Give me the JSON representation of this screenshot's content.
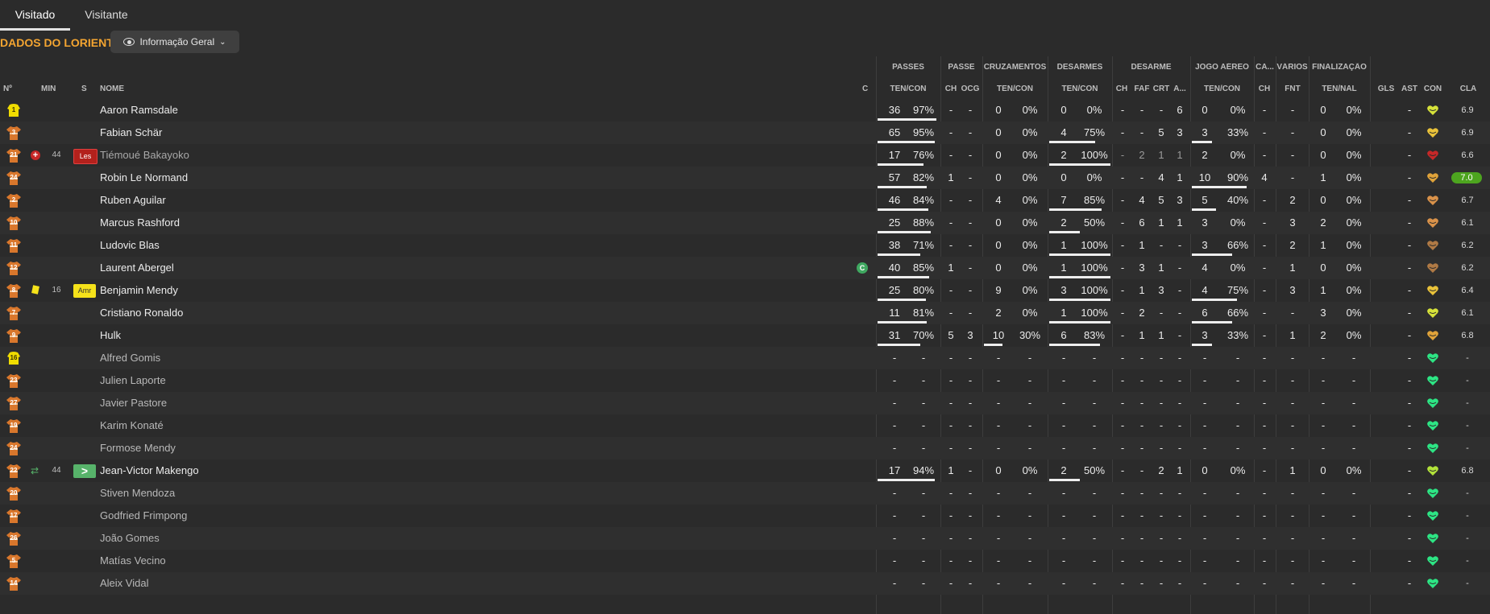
{
  "tabs": [
    "Visitado",
    "Visitante"
  ],
  "header": {
    "title": "DADOS DO LORIENT",
    "view": "Informação Geral"
  },
  "groups": [
    "PASSES",
    "PASSE",
    "CRUZAMENTOS",
    "DESARMES",
    "DESARME",
    "JOGO AÉREO",
    "CA...",
    "VÁRIOS",
    "FINALIZAÇÃO"
  ],
  "columns": {
    "no": "Nº",
    "min": "MIN",
    "s": "S",
    "name": "NOME",
    "c": "C",
    "passes": "TEN/CON",
    "passe_ch": "CH",
    "passe_ocg": "OCG",
    "cruz": "TEN/CON",
    "desarmes": "TEN/CON",
    "des_ch": "CH",
    "des_faf": "FAF",
    "des_crt": "CRT",
    "des_a": "A...",
    "aereo": "TEN/CON",
    "ca_ch": "CH",
    "fnt": "FNT",
    "fin": "TEN/NAL",
    "gls": "GLS",
    "ast": "AST",
    "con": "CON",
    "cla": "CLA"
  },
  "colors": {
    "accent": "#f4a531",
    "shirt": "#d9772c",
    "keeper": "#f0dc00",
    "heart": "#2de584",
    "rating_top": "#4da51f",
    "injury": "#c62828",
    "yellow_card": "#f5e21a",
    "sub_in": "#57b36a"
  },
  "players": [
    {
      "no": "1",
      "name": "Aaron Ramsdale",
      "keeper": true,
      "p": [
        "36",
        "97%"
      ],
      "pc": [
        "-",
        "-"
      ],
      "cz": [
        "0",
        "0%"
      ],
      "ds": [
        "0",
        "0%"
      ],
      "d4": [
        "-",
        "-",
        "-",
        "6"
      ],
      "ae": [
        "0",
        "0%"
      ],
      "ca": "-",
      "fnt": "-",
      "fn": [
        "0",
        "0%"
      ],
      "con": "-",
      "heart": "#d6e23a",
      "cla": "6.9",
      "pbar": 0.97,
      "dbar": 0,
      "abar": 0
    },
    {
      "no": "3",
      "name": "Fabian Schär",
      "p": [
        "65",
        "95%"
      ],
      "pc": [
        "-",
        "-"
      ],
      "cz": [
        "0",
        "0%"
      ],
      "ds": [
        "4",
        "75%"
      ],
      "d4": [
        "-",
        "-",
        "5",
        "3"
      ],
      "ae": [
        "3",
        "33%"
      ],
      "ca": "-",
      "fnt": "-",
      "fn": [
        "0",
        "0%"
      ],
      "con": "-",
      "heart": "#e9c23a",
      "cla": "6.9",
      "pbar": 0.95,
      "dbar": 0.75,
      "abar": 0.33
    },
    {
      "no": "21",
      "name": "Tiémoué Bakayoko",
      "injured": true,
      "min": "44",
      "status": "Les",
      "sub": true,
      "p": [
        "17",
        "76%"
      ],
      "pc": [
        "-",
        "-"
      ],
      "cz": [
        "0",
        "0%"
      ],
      "ds": [
        "2",
        "100%"
      ],
      "d4": [
        "-",
        "2",
        "1",
        "1"
      ],
      "ae": [
        "2",
        "0%"
      ],
      "ca": "-",
      "fnt": "-",
      "fn": [
        "0",
        "0%"
      ],
      "con": "-",
      "heart": "#c62828",
      "cla": "6.6",
      "pbar": 0.76,
      "dbar": 1,
      "abar": 0
    },
    {
      "no": "24",
      "name": "Robin Le Normand",
      "p": [
        "57",
        "82%"
      ],
      "pc": [
        "1",
        "-"
      ],
      "cz": [
        "0",
        "0%"
      ],
      "ds": [
        "0",
        "0%"
      ],
      "d4": [
        "-",
        "-",
        "4",
        "1"
      ],
      "ae": [
        "10",
        "90%"
      ],
      "ca": "4",
      "fnt": "-",
      "fn": [
        "1",
        "0%"
      ],
      "con": "-",
      "heart": "#e0a33a",
      "cla": "7.0",
      "top": true,
      "pbar": 0.82,
      "dbar": 0,
      "abar": 0.9
    },
    {
      "no": "2",
      "name": "Ruben Aguilar",
      "p": [
        "46",
        "84%"
      ],
      "pc": [
        "-",
        "-"
      ],
      "cz": [
        "4",
        "0%"
      ],
      "ds": [
        "7",
        "85%"
      ],
      "d4": [
        "-",
        "4",
        "5",
        "3"
      ],
      "ae": [
        "5",
        "40%"
      ],
      "ca": "-",
      "fnt": "2",
      "fn": [
        "0",
        "0%"
      ],
      "con": "-",
      "heart": "#d9924a",
      "cla": "6.7",
      "pbar": 0.84,
      "dbar": 0.85,
      "abar": 0.4
    },
    {
      "no": "10",
      "name": "Marcus Rashford",
      "p": [
        "25",
        "88%"
      ],
      "pc": [
        "-",
        "-"
      ],
      "cz": [
        "0",
        "0%"
      ],
      "ds": [
        "2",
        "50%"
      ],
      "d4": [
        "-",
        "6",
        "1",
        "1"
      ],
      "ae": [
        "3",
        "0%"
      ],
      "ca": "-",
      "fnt": "3",
      "fn": [
        "2",
        "0%"
      ],
      "con": "-",
      "heart": "#d9924a",
      "cla": "6.1",
      "pbar": 0.88,
      "dbar": 0.5,
      "abar": 0
    },
    {
      "no": "11",
      "name": "Ludovic Blas",
      "p": [
        "38",
        "71%"
      ],
      "pc": [
        "-",
        "-"
      ],
      "cz": [
        "0",
        "0%"
      ],
      "ds": [
        "1",
        "100%"
      ],
      "d4": [
        "-",
        "1",
        "-",
        "-"
      ],
      "ae": [
        "3",
        "66%"
      ],
      "ca": "-",
      "fnt": "2",
      "fn": [
        "1",
        "0%"
      ],
      "con": "-",
      "heart": "#b07a45",
      "cla": "6.2",
      "pbar": 0.71,
      "dbar": 1,
      "abar": 0.66
    },
    {
      "no": "12",
      "name": "Laurent Abergel",
      "captain": true,
      "p": [
        "40",
        "85%"
      ],
      "pc": [
        "1",
        "-"
      ],
      "cz": [
        "0",
        "0%"
      ],
      "ds": [
        "1",
        "100%"
      ],
      "d4": [
        "-",
        "3",
        "1",
        "-"
      ],
      "ae": [
        "4",
        "0%"
      ],
      "ca": "-",
      "fnt": "1",
      "fn": [
        "0",
        "0%"
      ],
      "con": "-",
      "heart": "#b07a45",
      "cla": "6.2",
      "pbar": 0.85,
      "dbar": 1,
      "abar": 0
    },
    {
      "no": "8",
      "name": "Benjamin Mendy",
      "card": true,
      "min": "16",
      "status": "Amr",
      "p": [
        "25",
        "80%"
      ],
      "pc": [
        "-",
        "-"
      ],
      "cz": [
        "9",
        "0%"
      ],
      "ds": [
        "3",
        "100%"
      ],
      "d4": [
        "-",
        "1",
        "3",
        "-"
      ],
      "ae": [
        "4",
        "75%"
      ],
      "ca": "-",
      "fnt": "3",
      "fn": [
        "1",
        "0%"
      ],
      "con": "-",
      "heart": "#e9c23a",
      "cla": "6.4",
      "pbar": 0.8,
      "dbar": 1,
      "abar": 0.75
    },
    {
      "no": "7",
      "name": "Cristiano Ronaldo",
      "p": [
        "11",
        "81%"
      ],
      "pc": [
        "-",
        "-"
      ],
      "cz": [
        "2",
        "0%"
      ],
      "ds": [
        "1",
        "100%"
      ],
      "d4": [
        "-",
        "2",
        "-",
        "-"
      ],
      "ae": [
        "6",
        "66%"
      ],
      "ca": "-",
      "fnt": "-",
      "fn": [
        "3",
        "0%"
      ],
      "con": "-",
      "heart": "#d6e23a",
      "cla": "6.1",
      "pbar": 0.81,
      "dbar": 1,
      "abar": 0.66
    },
    {
      "no": "9",
      "name": "Hulk",
      "p": [
        "31",
        "70%"
      ],
      "pc": [
        "5",
        "3"
      ],
      "cz": [
        "10",
        "30%"
      ],
      "ds": [
        "6",
        "83%"
      ],
      "d4": [
        "-",
        "1",
        "1",
        "-"
      ],
      "ae": [
        "3",
        "33%"
      ],
      "ca": "-",
      "fnt": "1",
      "fn": [
        "2",
        "0%"
      ],
      "con": "-",
      "heart": "#e0a33a",
      "cla": "6.8",
      "pbar": 0.7,
      "cbar": 0.3,
      "dbar": 0.83,
      "abar": 0.33
    },
    {
      "no": "16",
      "name": "Alfred Gomis",
      "keeper": true,
      "bench": true
    },
    {
      "no": "23",
      "name": "Julien Laporte",
      "bench": true
    },
    {
      "no": "27",
      "name": "Javier Pastore",
      "bench": true
    },
    {
      "no": "19",
      "name": "Karim Konaté",
      "bench": true
    },
    {
      "no": "24",
      "name": "Formose Mendy",
      "bench": true
    },
    {
      "no": "22",
      "name": "Jean-Victor Makengo",
      "subin": true,
      "min": "44",
      "status": ">",
      "p": [
        "17",
        "94%"
      ],
      "pc": [
        "1",
        "-"
      ],
      "cz": [
        "0",
        "0%"
      ],
      "ds": [
        "2",
        "50%"
      ],
      "d4": [
        "-",
        "-",
        "2",
        "1"
      ],
      "ae": [
        "0",
        "0%"
      ],
      "ca": "-",
      "fnt": "1",
      "fn": [
        "0",
        "0%"
      ],
      "con": "-",
      "heart": "#b2e23a",
      "cla": "6.8",
      "pbar": 0.94,
      "dbar": 0.5,
      "abar": 0
    },
    {
      "no": "20",
      "name": "Stiven Mendoza",
      "bench": true
    },
    {
      "no": "17",
      "name": "Godfried Frimpong",
      "bench": true
    },
    {
      "no": "26",
      "name": "João Gomes",
      "bench": true
    },
    {
      "no": "5",
      "name": "Matías Vecino",
      "bench": true
    },
    {
      "no": "14",
      "name": "Aleix Vidal",
      "bench": true
    }
  ]
}
